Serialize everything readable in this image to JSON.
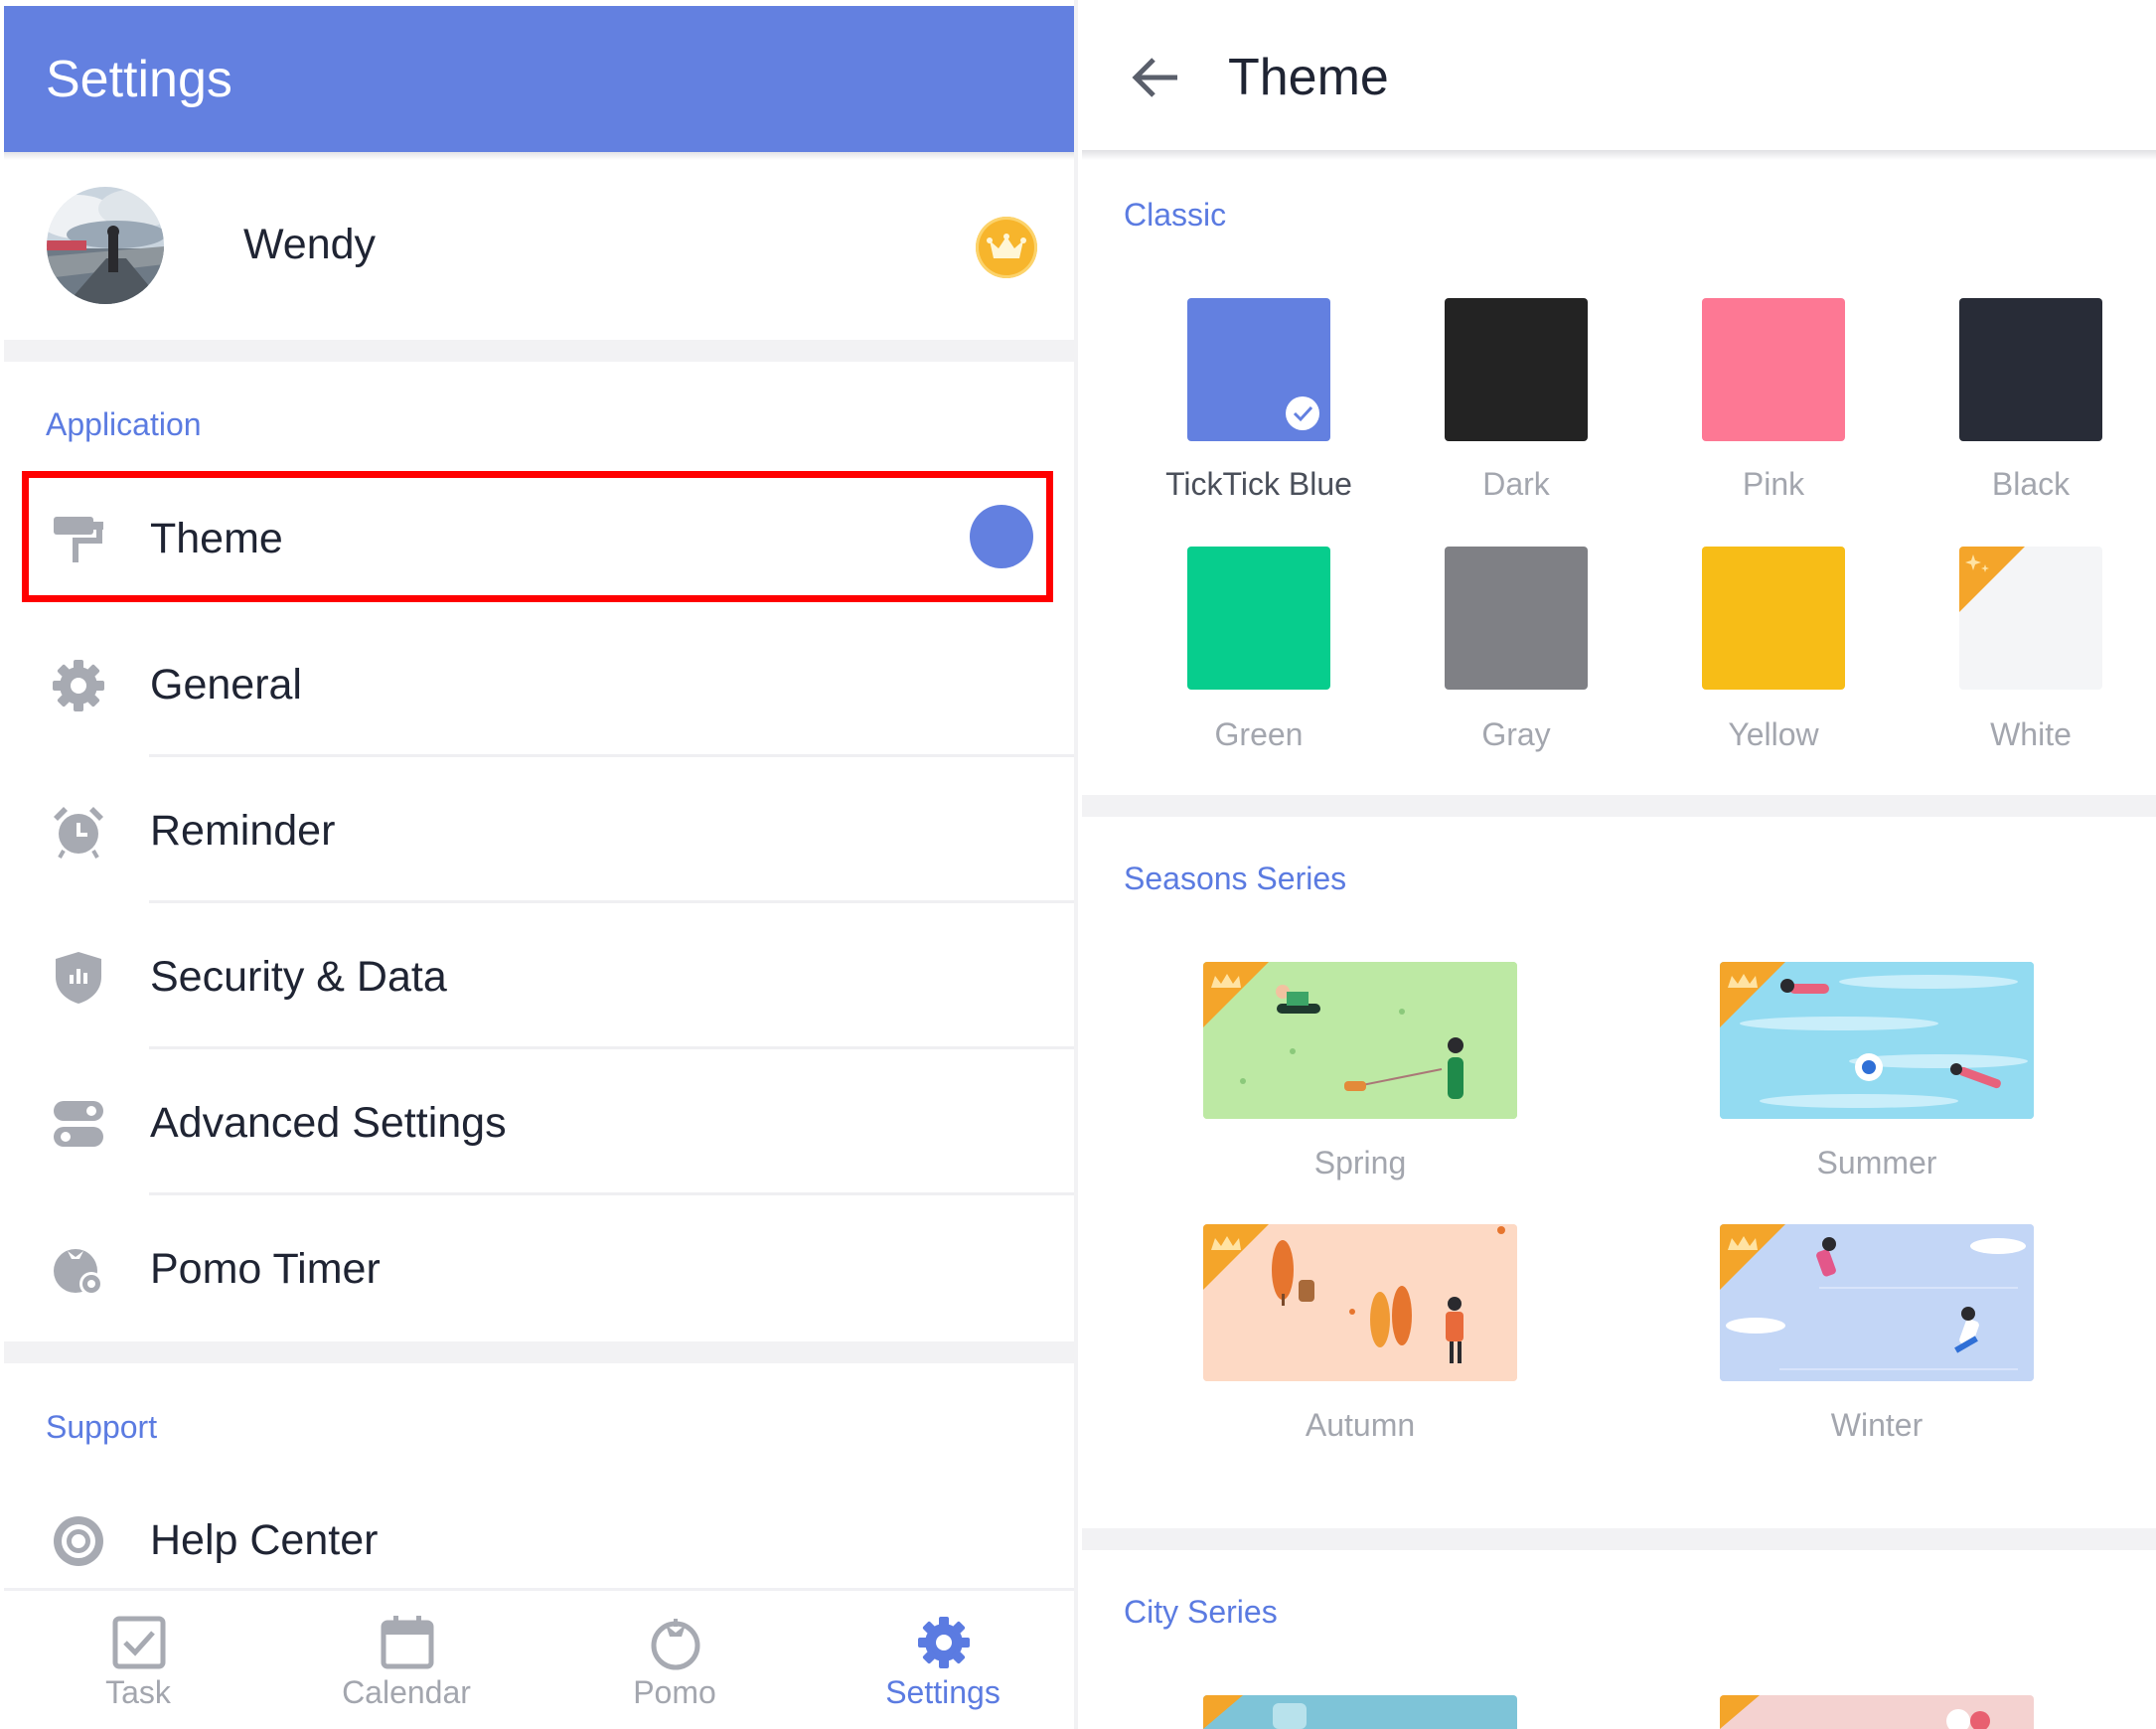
{
  "left": {
    "title": "Settings",
    "profile": {
      "name": "Wendy"
    },
    "section_application": "Application",
    "menu": [
      {
        "label": "Theme",
        "icon": "paint-roller-icon"
      },
      {
        "label": "General",
        "icon": "gear-icon"
      },
      {
        "label": "Reminder",
        "icon": "alarm-clock-icon"
      },
      {
        "label": "Security & Data",
        "icon": "shield-icon"
      },
      {
        "label": "Advanced Settings",
        "icon": "toggles-icon"
      },
      {
        "label": "Pomo Timer",
        "icon": "tomato-gear-icon"
      }
    ],
    "section_support": "Support",
    "help_center": "Help Center",
    "nav": [
      {
        "label": "Task",
        "icon": "checkbox-icon"
      },
      {
        "label": "Calendar",
        "icon": "calendar-icon"
      },
      {
        "label": "Pomo",
        "icon": "tomato-icon"
      },
      {
        "label": "Settings",
        "icon": "gear-icon",
        "active": true
      }
    ]
  },
  "right": {
    "title": "Theme",
    "classic_label": "Classic",
    "classic": [
      {
        "name": "TickTick Blue",
        "color": "#6380e0",
        "selected": true
      },
      {
        "name": "Dark",
        "color": "#232323"
      },
      {
        "name": "Pink",
        "color": "#fd7894"
      },
      {
        "name": "Black",
        "color": "#282c37"
      },
      {
        "name": "Green",
        "color": "#07cd8d"
      },
      {
        "name": "Gray",
        "color": "#7f8085"
      },
      {
        "name": "Yellow",
        "color": "#f7bd17"
      },
      {
        "name": "White",
        "color": "#f4f5f7",
        "premium": true
      }
    ],
    "seasons_label": "Seasons Series",
    "seasons": [
      {
        "name": "Spring",
        "color": "#b9e8a0"
      },
      {
        "name": "Summer",
        "color": "#8cd8ef"
      },
      {
        "name": "Autumn",
        "color": "#fcd7c2"
      },
      {
        "name": "Winter",
        "color": "#c6d7f7"
      }
    ],
    "city_label": "City Series"
  },
  "colors": {
    "accent": "#6380e0",
    "label_blue": "#5b7be1",
    "premium_orange": "#f4a52a",
    "highlight_red": "#ff0000"
  }
}
